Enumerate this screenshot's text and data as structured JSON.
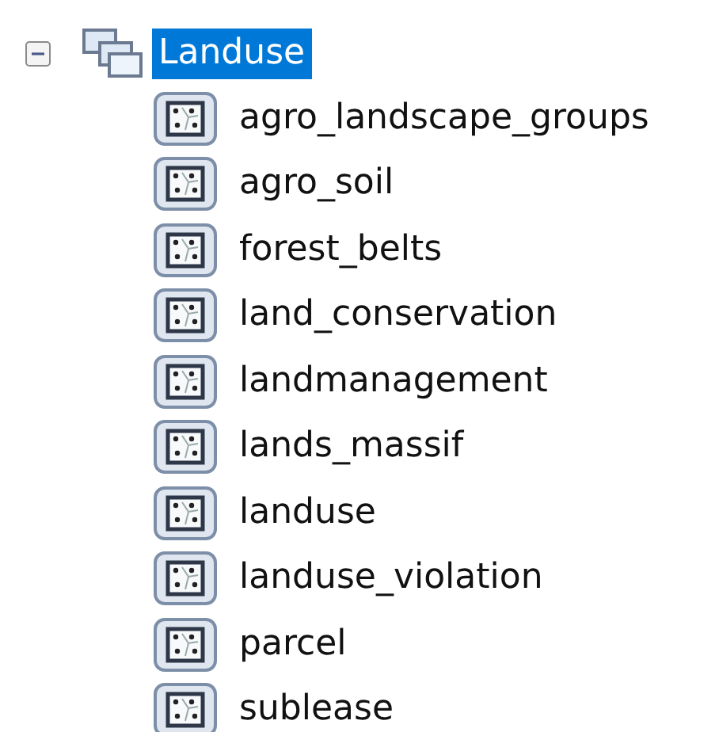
{
  "tree": {
    "label": "Landuse",
    "expanded": true,
    "selected": true,
    "children": [
      {
        "label": "agro_landscape_groups",
        "selected": false
      },
      {
        "label": "agro_soil",
        "selected": false
      },
      {
        "label": "forest_belts",
        "selected": false
      },
      {
        "label": "land_conservation",
        "selected": false
      },
      {
        "label": "landmanagement",
        "selected": false
      },
      {
        "label": "lands_massif",
        "selected": false
      },
      {
        "label": "landuse",
        "selected": false
      },
      {
        "label": "landuse_violation",
        "selected": false
      },
      {
        "label": "parcel",
        "selected": false
      },
      {
        "label": "sublease",
        "selected": false
      }
    ]
  }
}
